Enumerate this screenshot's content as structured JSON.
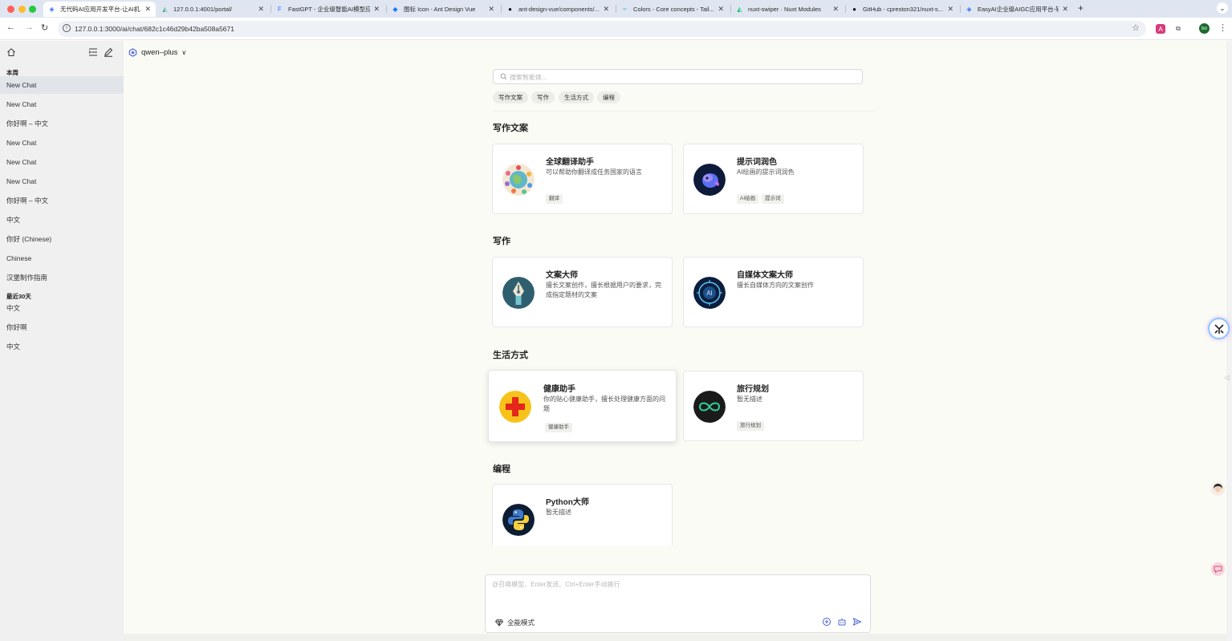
{
  "browser": {
    "tabs": [
      {
        "title": "无代码AI应用开发平台-让AI机...",
        "active": true
      },
      {
        "title": "127.0.0.1:4001/portal/",
        "active": false
      },
      {
        "title": "FastGPT - 企业级智能AI模型应...",
        "active": false
      },
      {
        "title": "图标 Icon - Ant Design Vue",
        "active": false
      },
      {
        "title": "ant-design-vue/components/...",
        "active": false
      },
      {
        "title": "Colors - Core concepts - Tail...",
        "active": false
      },
      {
        "title": "nuxt-swiper · Nuxt Modules",
        "active": false
      },
      {
        "title": "GitHub - cpreston321/nuxt-s...",
        "active": false
      },
      {
        "title": "EasyAI企业级AIGC应用平台-轻...",
        "active": false
      }
    ],
    "url": "127.0.0.1:3000/ai/chat/682c1c46d29b42ba508a5671",
    "profile_initials": "bo"
  },
  "sidebar": {
    "groups": [
      {
        "label": "本周",
        "items": [
          "New Chat",
          "New Chat",
          "你好啊 – 中文",
          "New Chat",
          "New Chat",
          "New Chat",
          "你好啊 – 中文",
          "中文",
          "你好 (Chinese)",
          "Chinese",
          "汉堡制作指南"
        ]
      },
      {
        "label": "最近30天",
        "items": [
          "中文",
          "你好啊",
          "中文"
        ]
      }
    ]
  },
  "model_selector": {
    "label": "qwen–plus"
  },
  "search": {
    "placeholder": "搜索智能体..."
  },
  "filters": [
    "写作文案",
    "写作",
    "生活方式",
    "编程"
  ],
  "sections": [
    {
      "title": "写作文案",
      "cards": [
        {
          "title": "全球翻译助手",
          "desc": "可以帮助你翻译成任务国家的语言",
          "tags": [
            "翻译"
          ],
          "icon": "globe-translate-icon"
        },
        {
          "title": "提示词润色",
          "desc": "AI绘画的提示词润色",
          "tags": [
            "AI绘画",
            "提示词"
          ],
          "icon": "paint-bird-icon"
        }
      ]
    },
    {
      "title": "写作",
      "cards": [
        {
          "title": "文案大师",
          "desc": "擅长文案创作，擅长根据用户的要求，完成指定题材的文案",
          "tags": [],
          "icon": "fountain-pen-icon"
        },
        {
          "title": "自媒体文案大师",
          "desc": "擅长自媒体方向的文案创作",
          "tags": [],
          "icon": "ai-circuit-icon"
        }
      ]
    },
    {
      "title": "生活方式",
      "cards": [
        {
          "title": "健康助手",
          "desc": "你的贴心健康助手，擅长处理健康方面的问题",
          "tags": [
            "健康助手"
          ],
          "icon": "medical-cross-icon"
        },
        {
          "title": "旅行规划",
          "desc": "暂无描述",
          "tags": [
            "旅行规划"
          ],
          "icon": "infinity-icon"
        }
      ]
    },
    {
      "title": "编程",
      "cards": [
        {
          "title": "Python大师",
          "desc": "暂无描述",
          "tags": [],
          "icon": "python-icon"
        }
      ]
    }
  ],
  "composer": {
    "placeholder": "@召唤模型、Enter发送、Ctrl+Enter手动换行",
    "mode_label": "全能模式"
  },
  "colors": {
    "accent": "#1677ff",
    "sidebar_bg": "#eff0ef",
    "page_bg": "#fbfbf6"
  }
}
